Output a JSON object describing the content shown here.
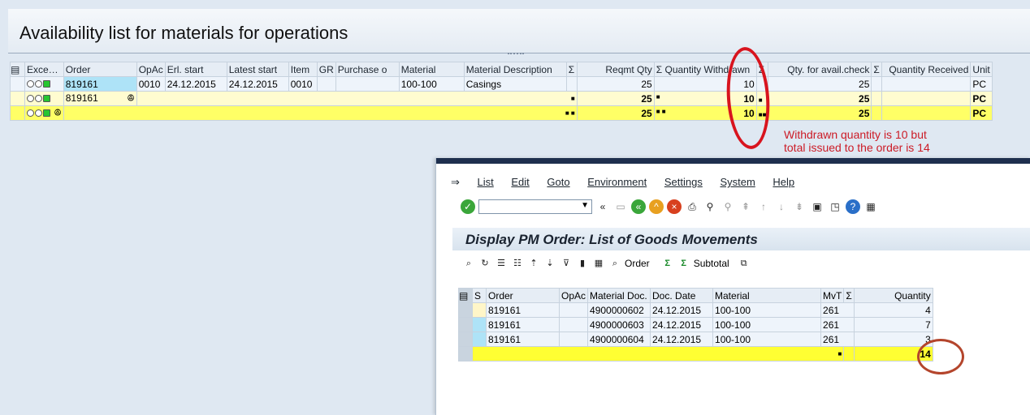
{
  "top": {
    "title": "Availability list for materials for operations",
    "columns": [
      "Exce…",
      "Order",
      "OpAc",
      "Erl. start",
      "Latest start",
      "Item",
      "GR",
      "Purchase o",
      "Material",
      "Material Description",
      "Σ",
      "Reqmt Qty",
      "Σ Quantity Withdrawn",
      "Σ",
      "Qty. for avail.check",
      "Σ",
      "Quantity Received",
      "Unit"
    ],
    "rows": [
      {
        "order": "819161",
        "opac": "0010",
        "erl_start": "24.12.2015",
        "latest_start": "24.12.2015",
        "item": "0010",
        "material": "100-100",
        "desc": "Casings",
        "reqmt_qty": "25",
        "withdrawn": "10",
        "avail_qty": "25",
        "unit": "PC"
      },
      {
        "order": "819161",
        "reqmt_qty": "25",
        "withdrawn": "10",
        "avail_qty": "25",
        "unit": "PC"
      },
      {
        "reqmt_qty": "25",
        "withdrawn": "10",
        "avail_qty": "25",
        "unit": "PC"
      }
    ]
  },
  "annotation": {
    "line1": "Withdrawn quantity is 10 but",
    "line2": "total issued to the order is 14"
  },
  "sub": {
    "menu": [
      "List",
      "Edit",
      "Goto",
      "Environment",
      "Settings",
      "System",
      "Help"
    ],
    "title": "Display PM Order: List of Goods Movements",
    "alv_order_label": "Order",
    "alv_subtotal_label": "Subtotal",
    "columns": [
      "S",
      "Order",
      "OpAc",
      "Material Doc.",
      "Doc. Date",
      "Material",
      "MvT",
      "Σ",
      "Quantity"
    ],
    "rows": [
      {
        "order": "819161",
        "doc": "4900000602",
        "date": "24.12.2015",
        "material": "100-100",
        "mvt": "261",
        "qty": "4"
      },
      {
        "order": "819161",
        "doc": "4900000603",
        "date": "24.12.2015",
        "material": "100-100",
        "mvt": "261",
        "qty": "7"
      },
      {
        "order": "819161",
        "doc": "4900000604",
        "date": "24.12.2015",
        "material": "100-100",
        "mvt": "261",
        "qty": "3"
      }
    ],
    "total": "14"
  },
  "colors": {
    "accent_red": "#d8141e",
    "total_yellow": "#ffff33"
  }
}
